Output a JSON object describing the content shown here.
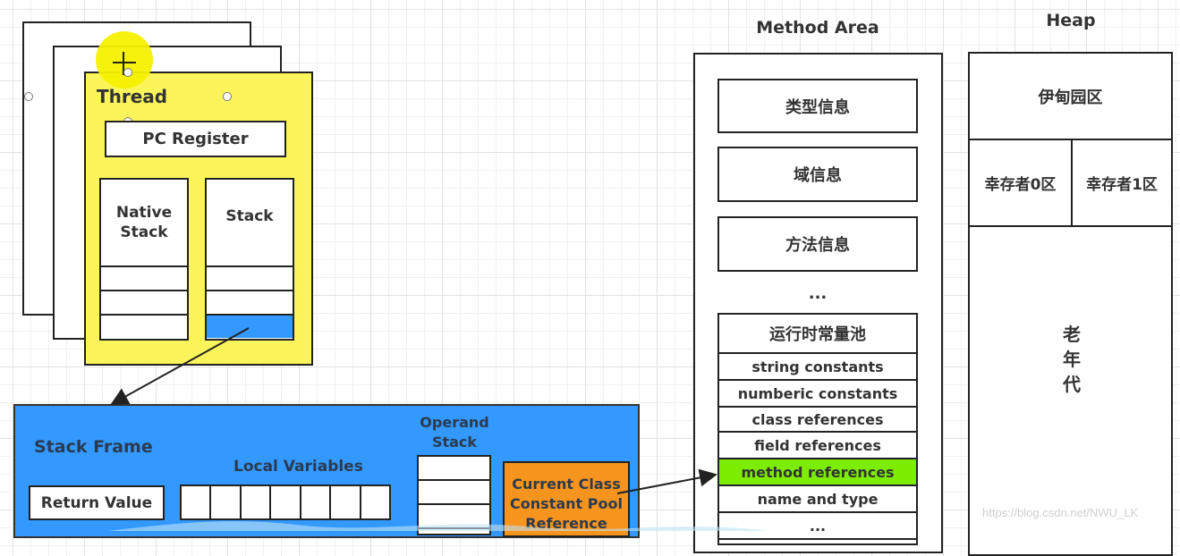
{
  "thread": {
    "title": "Thread",
    "pc_register": "PC Register",
    "native_stack": "Native Stack",
    "java_stack": "Stack",
    "native_stack_frames": 3,
    "java_stack_frames": 3,
    "active_frame_index": 2
  },
  "stack_frame": {
    "title": "Stack Frame",
    "return_value": "Return Value",
    "local_variables_label": "Local Variables",
    "local_variable_slots": 7,
    "operand_stack_label": "Operand Stack",
    "operand_stack_slots": 3,
    "constant_pool_reference": "Current Class Constant Pool Reference"
  },
  "method_area": {
    "title": "Method Area",
    "items": [
      "类型信息",
      "域信息",
      "方法信息"
    ],
    "ellipsis": "...",
    "runtime_constant_pool": {
      "title": "运行时常量池",
      "entries": [
        {
          "label": "string constants",
          "highlighted": false
        },
        {
          "label": "numberic constants",
          "highlighted": false
        },
        {
          "label": "class references",
          "highlighted": false
        },
        {
          "label": "field references",
          "highlighted": false
        },
        {
          "label": "method references",
          "highlighted": true
        },
        {
          "label": "name and type",
          "highlighted": false
        },
        {
          "label": "...",
          "highlighted": false
        }
      ]
    }
  },
  "heap": {
    "title": "Heap",
    "eden": "伊甸园区",
    "survivor0": "幸存者0区",
    "survivor1": "幸存者1区",
    "old_gen": "老年代"
  },
  "colors": {
    "thread_fill": "#fbf55b",
    "stack_frame_fill": "#3399ff",
    "constant_pool_ref_fill": "#f7941d",
    "highlight_fill": "#7ded00"
  },
  "watermark": "https://blog.csdn.net/NWU_LK"
}
